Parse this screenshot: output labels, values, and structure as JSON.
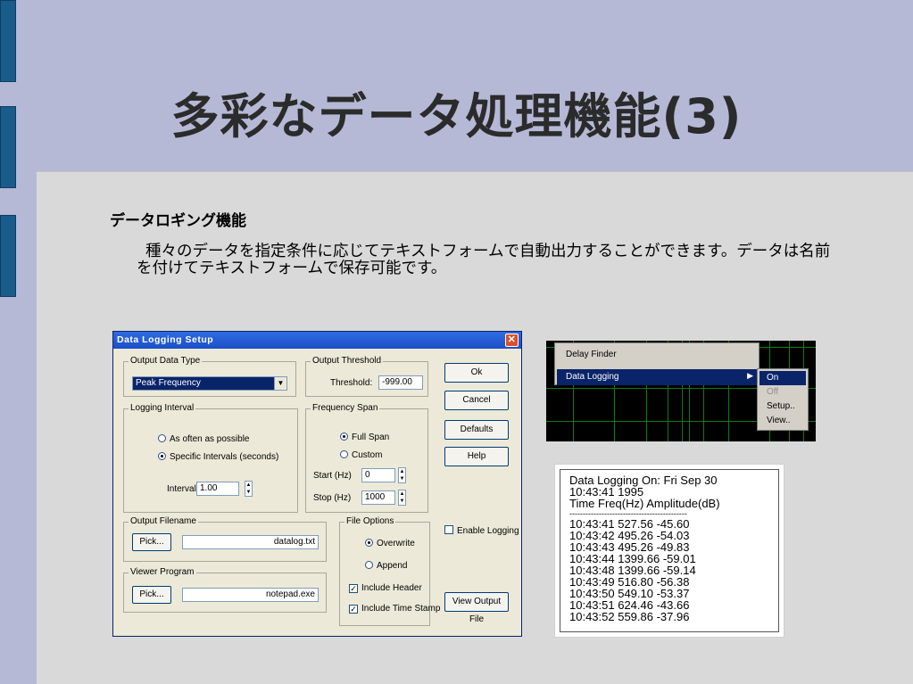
{
  "title": "多彩なデータ処理機能(3)",
  "subheading": "データロギング機能",
  "body": "種々のデータを指定条件に応じてテキストフォームで自動出力することができます。データは名前を付けてテキストフォームで保存可能です。",
  "dialog": {
    "title": "Data Logging Setup",
    "output_data_type": {
      "label": "Output Data Type",
      "value": "Peak Frequency"
    },
    "output_threshold": {
      "label": "Output Threshold",
      "field_label": "Threshold:",
      "value": "-999.00"
    },
    "logging_interval": {
      "label": "Logging Interval",
      "options": [
        "As often as possible",
        "Specific Intervals (seconds)"
      ],
      "selected": 1,
      "interval_label": "Interval:",
      "interval_value": "1.00"
    },
    "frequency_span": {
      "label": "Frequency Span",
      "options": [
        "Full Span",
        "Custom"
      ],
      "selected": 0,
      "start_label": "Start (Hz)",
      "start_value": "0",
      "stop_label": "Stop (Hz)",
      "stop_value": "1000"
    },
    "output_filename": {
      "label": "Output Filename",
      "pick": "Pick...",
      "value": "datalog.txt"
    },
    "viewer_program": {
      "label": "Viewer Program",
      "pick": "Pick...",
      "value": "notepad.exe"
    },
    "file_options": {
      "label": "File Options",
      "options": [
        "Overwrite",
        "Append"
      ],
      "selected": 0,
      "include_header": "Include Header",
      "include_time_stamp": "Include Time Stamp"
    },
    "buttons": {
      "ok": "Ok",
      "cancel": "Cancel",
      "defaults": "Defaults",
      "help": "Help",
      "view_output": "View Output File"
    },
    "enable_logging": "Enable Logging"
  },
  "menu": {
    "items": [
      "Delay Finder",
      "Data Logging"
    ],
    "submenu": [
      "On",
      "Off",
      "Setup..",
      "View.."
    ]
  },
  "output": {
    "lines": [
      "Data Logging On: Fri Sep 30",
      "10:43:41 1995",
      "Time Freq(Hz) Amplitude(dB)",
      "--------------------------------------------",
      "10:43:41 527.56 -45.60",
      "10:43:42 495.26 -54.03",
      "10:43:43 495.26 -49.83",
      "10:43:44 1399.66 -59.01",
      "10:43:48 1399.66 -59.14",
      "10:43:49 516.80 -56.38",
      "10:43:50 549.10 -53.37",
      "10:43:51 624.46 -43.66",
      "10:43:52 559.86 -37.96"
    ]
  }
}
